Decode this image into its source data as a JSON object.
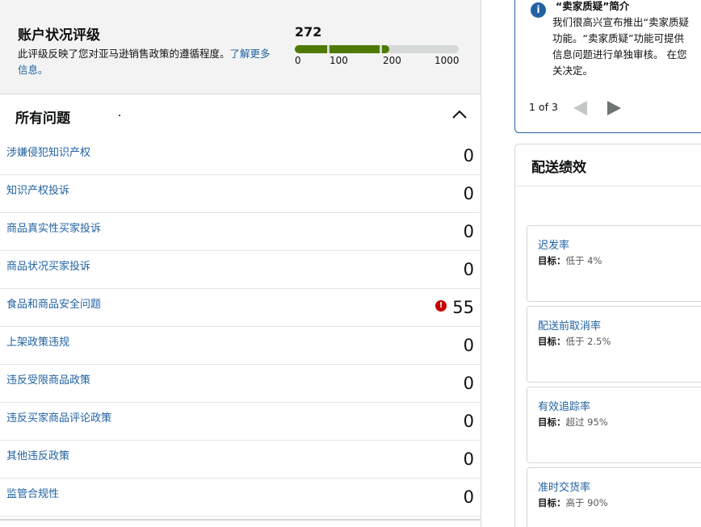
{
  "account_health": {
    "title": "账户状况评级",
    "description": "此评级反映了您对亚马逊销售政策的遵循程度。",
    "learn_more": "了解更多信息。",
    "score": "272",
    "ticks": [
      "0",
      "100",
      "200",
      "1000"
    ],
    "colors": {
      "bar": "#4f7a00",
      "track": "#d5d9d9"
    }
  },
  "issues": {
    "title": "所有问题",
    "collapse_icon": "chevron-up-icon",
    "rows": [
      {
        "label": "涉嫌侵犯知识产权",
        "value": "0"
      },
      {
        "label": "知识产权投诉",
        "value": "0"
      },
      {
        "label": "商品真实性买家投诉",
        "value": "0"
      },
      {
        "label": "商品状况买家投诉",
        "value": "0"
      },
      {
        "label": "食品和商品安全问题",
        "value": "55",
        "alert": true
      },
      {
        "label": "上架政策违规",
        "value": "0"
      },
      {
        "label": "违反受限商品政策",
        "value": "0"
      },
      {
        "label": "违反买家商品评论政策",
        "value": "0"
      },
      {
        "label": "其他违反政策",
        "value": "0"
      },
      {
        "label": "监管合规性",
        "value": "0"
      }
    ]
  },
  "notice": {
    "title": "“卖家质疑”简介",
    "body": "我们很高兴宣布推出“卖家质疑\n功能。“卖家质疑”功能可提供\n信息问题进行单独审核。 在您\n关决定。",
    "pager": "1 of 3",
    "info_icon": "info-icon",
    "alert_mark": "!"
  },
  "delivery": {
    "title": "配送绩效",
    "target_prefix": "目标：",
    "metrics": [
      {
        "name": "迟发率",
        "target_rule": "低于 4%"
      },
      {
        "name": "配送前取消率",
        "target_rule": "低于 2.5%"
      },
      {
        "name": "有效追踪率",
        "target_rule": "超过 95%"
      },
      {
        "name": "准时交货率",
        "target_rule": "高于 90%"
      }
    ]
  },
  "colors": {
    "link": "#2162a1",
    "alert": "#c40000",
    "border": "#d5d9d9"
  }
}
